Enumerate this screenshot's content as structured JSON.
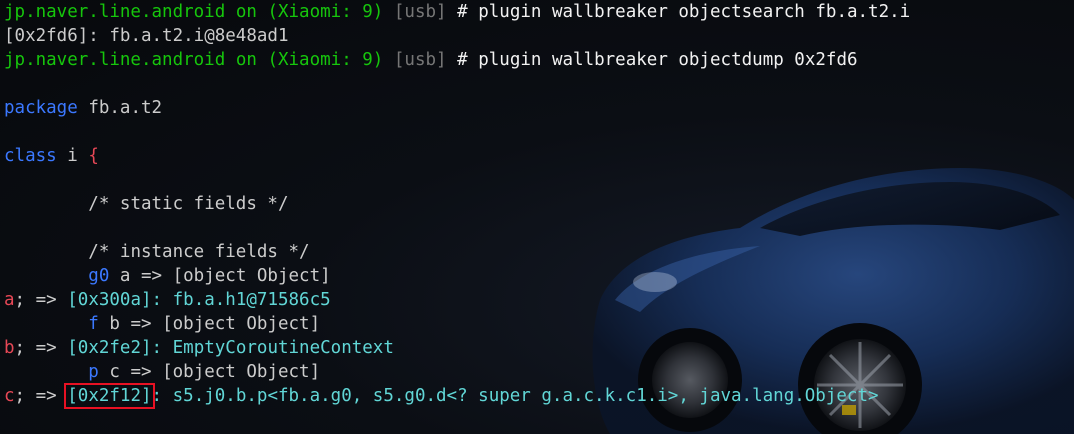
{
  "terminal": {
    "prompt": {
      "package": "jp.naver.line.android",
      "on": "on",
      "device": "(Xiaomi: 9)",
      "transport": "[usb]",
      "hash": "#"
    },
    "commands": [
      "plugin wallbreaker objectsearch fb.a.t2.i",
      "plugin wallbreaker objectdump 0x2fd6"
    ],
    "search_result": {
      "handle": "[0x2fd6]:",
      "value": "fb.a.t2.i@8e48ad1"
    },
    "dump": {
      "package_kw": "package",
      "package_name": "fb.a.t2",
      "class_kw": "class",
      "class_name": "i",
      "brace": "{",
      "static_comment": "/* static fields */",
      "instance_comment": "/* instance fields */",
      "fields": [
        {
          "type": "g0",
          "name": "a",
          "decl_rest": " => [object Object]",
          "ref_name": "a",
          "ref_sep": "; =>",
          "addr": "[0x300a]",
          "value": ": fb.a.h1@71586c5",
          "highlighted": false
        },
        {
          "type": "f",
          "name": "b",
          "decl_rest": " => [object Object]",
          "ref_name": "b",
          "ref_sep": "; =>",
          "addr": "[0x2fe2]",
          "value": ": EmptyCoroutineContext",
          "highlighted": false
        },
        {
          "type": "p",
          "name": "c",
          "decl_rest": " => [object Object]",
          "ref_name": "c",
          "ref_sep": "; =>",
          "addr": "[0x2f12]",
          "value": ": s5.j0.b.p<fb.a.g0, s5.g0.d<? super g.a.c.k.c1.i>, java.lang.Object>",
          "highlighted": true
        }
      ]
    },
    "background": "car-wallpaper",
    "colors": {
      "prompt_package": "#16c60c",
      "dim": "#767676",
      "keyword": "#3b78ff",
      "field_ref": "#e74856",
      "address": "#61d6d6",
      "text": "#cccccc",
      "highlight_box": "#e81123"
    }
  }
}
